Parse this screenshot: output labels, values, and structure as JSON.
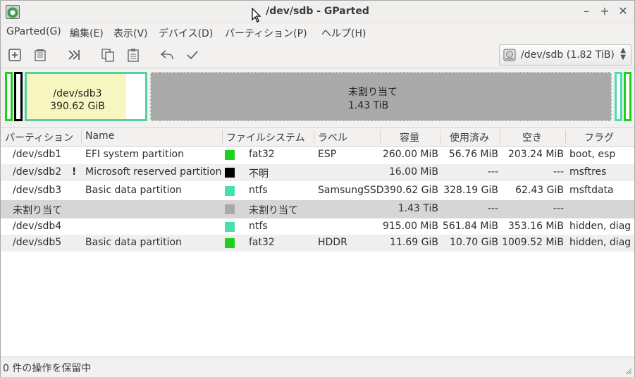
{
  "window": {
    "title": "/dev/sdb - GParted"
  },
  "menu": [
    "GParted(G)",
    "編集(E)",
    "表示(V)",
    "デバイス(D)",
    "パーティション(P)",
    "ヘルプ(H)"
  ],
  "toolbar": {
    "buttons": [
      "new-icon",
      "delete-icon",
      "resize-move-icon",
      "copy-icon",
      "paste-icon",
      "undo-icon",
      "apply-icon"
    ]
  },
  "device_selector": {
    "label": "/dev/sdb  (1.82 TiB)"
  },
  "disk_map": {
    "sdb3": {
      "name": "/dev/sdb3",
      "size": "390.62 GiB"
    },
    "unallocated": {
      "name": "未割り当て",
      "size": "1.43 TiB"
    }
  },
  "table": {
    "headers": [
      "パーティション",
      "Name",
      "ファイルシステム",
      "ラベル",
      "容量",
      "使用済み",
      "空き",
      "フラグ"
    ],
    "rows": [
      {
        "partition": "/dev/sdb1",
        "warn": "",
        "name": "EFI system partition",
        "fs_color": "#1fd11f",
        "fs": "fat32",
        "label": "ESP",
        "size": "260.00 MiB",
        "used": "56.76 MiB",
        "free": "203.24 MiB",
        "flags": "boot, esp"
      },
      {
        "partition": "/dev/sdb2",
        "warn": "!",
        "name": "Microsoft reserved partition",
        "fs_color": "#000000",
        "fs": "不明",
        "label": "",
        "size": "16.00 MiB",
        "used": "---",
        "free": "---",
        "flags": "msftres"
      },
      {
        "partition": "/dev/sdb3",
        "warn": "",
        "name": "Basic data partition",
        "fs_color": "#47e0ad",
        "fs": "ntfs",
        "label": "SamsungSSD",
        "size": "390.62 GiB",
        "used": "328.19 GiB",
        "free": "62.43 GiB",
        "flags": "msftdata"
      },
      {
        "partition": "未割り当て",
        "warn": "",
        "name": "",
        "fs_color": "#a9a9a9",
        "fs": "未割り当て",
        "label": "",
        "size": "1.43 TiB",
        "used": "---",
        "free": "---",
        "flags": ""
      },
      {
        "partition": "/dev/sdb4",
        "warn": "",
        "name": "",
        "fs_color": "#47e0ad",
        "fs": "ntfs",
        "label": "",
        "size": "915.00 MiB",
        "used": "561.84 MiB",
        "free": "353.16 MiB",
        "flags": "hidden, diag"
      },
      {
        "partition": "/dev/sdb5",
        "warn": "",
        "name": "Basic data partition",
        "fs_color": "#1fd11f",
        "fs": "fat32",
        "label": "HDDR",
        "size": "11.69 GiB",
        "used": "10.70 GiB",
        "free": "1009.52 MiB",
        "flags": "hidden, diag"
      }
    ]
  },
  "status": {
    "text": "0 件の操作を保留中"
  }
}
